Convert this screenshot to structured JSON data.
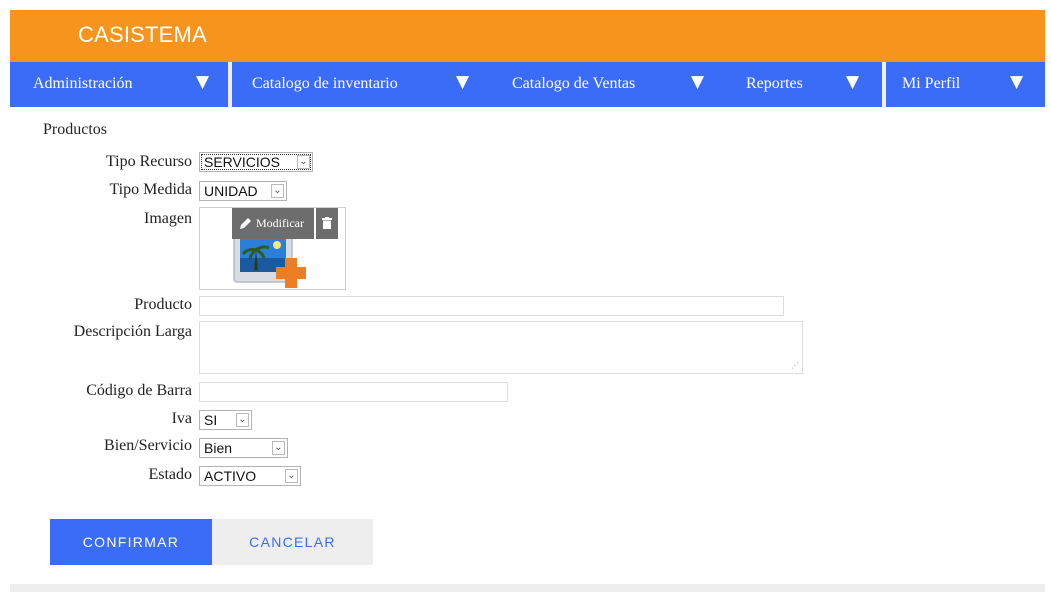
{
  "app": {
    "brand": "CASISTEMA"
  },
  "nav": {
    "items": [
      {
        "label": "Administración",
        "arrow": "▼"
      },
      {
        "label": "Catalogo de inventario",
        "arrow": "▼"
      },
      {
        "label": "Catalogo de Ventas",
        "arrow": "▼"
      },
      {
        "label": "Reportes",
        "arrow": "▼"
      },
      {
        "label": "Mi Perfil",
        "arrow": "▼"
      }
    ]
  },
  "form": {
    "title": "Productos",
    "tipo_recurso": {
      "label": "Tipo Recurso",
      "value": "SERVICIOS"
    },
    "tipo_medida": {
      "label": "Tipo Medida",
      "value": "UNIDAD"
    },
    "imagen": {
      "label": "Imagen",
      "modify_label": "Modificar",
      "icon": "placeholder-image-add-icon"
    },
    "producto": {
      "label": "Producto",
      "value": ""
    },
    "descripcion": {
      "label": "Descripción Larga",
      "value": ""
    },
    "codigo_barra": {
      "label": "Código de Barra",
      "value": ""
    },
    "iva": {
      "label": "Iva",
      "value": "SI"
    },
    "bien_servicio": {
      "label": "Bien/Servicio",
      "value": "Bien"
    },
    "estado": {
      "label": "Estado",
      "value": "ACTIVO"
    }
  },
  "actions": {
    "confirm_label": "CONFIRMAR",
    "cancel_label": "CANCELAR"
  },
  "colors": {
    "header": "#f7941d",
    "nav": "#3b6cf8",
    "confirm": "#3b6cf8",
    "cancel_bg": "#eeeeee"
  }
}
